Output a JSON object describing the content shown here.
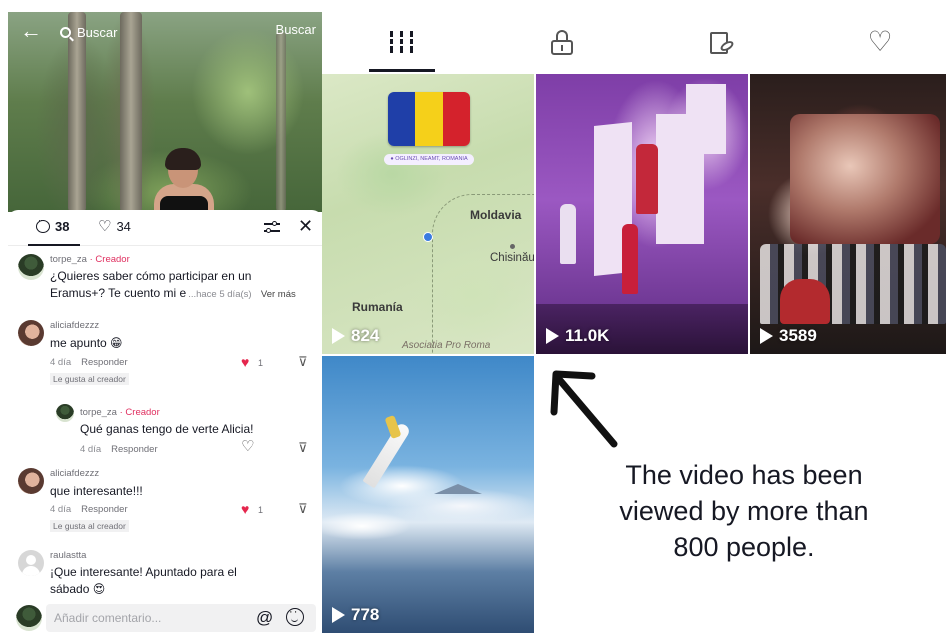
{
  "video": {
    "search_label": "Buscar",
    "search_button": "Buscar"
  },
  "comments_sheet": {
    "comment_count": "38",
    "like_count": "34",
    "comments": [
      {
        "username": "torpe_za",
        "creator_tag": "· Creador",
        "text_line1": "¿Quieres saber cómo participar en un",
        "text_line2": "Eramus+? Te cuento mi e",
        "time": "...hace 5 día(s)",
        "see_more": "Ver más"
      },
      {
        "username": "aliciafdezzz",
        "text": "me apunto 😁",
        "time": "4 día",
        "reply": "Responder",
        "likes": "1",
        "liked_by_creator": "Le gusta al creador",
        "replies": [
          {
            "username": "torpe_za",
            "creator_tag": "· Creador",
            "text": "Qué ganas tengo de verte Alicia!",
            "time": "4 día",
            "reply": "Responder"
          }
        ]
      },
      {
        "username": "aliciafdezzz",
        "text": "que interesante!!!",
        "time": "4 día",
        "reply": "Responder",
        "likes": "1",
        "liked_by_creator": "Le gusta al creador"
      },
      {
        "username": "raulastta",
        "text_line1": "¡Que interesante! Apuntado para el",
        "text_line2": "sábado 😍"
      }
    ],
    "input_placeholder": "Añadir comentario..."
  },
  "profile_tabs": [
    {
      "icon": "grid-icon",
      "active": true
    },
    {
      "icon": "lock-icon",
      "active": false
    },
    {
      "icon": "tagged-icon",
      "active": false
    },
    {
      "icon": "heart-icon",
      "active": false
    }
  ],
  "videos": [
    {
      "views": "824",
      "location": "● OGLINZI, NEAMT, ROMANIA",
      "map_labels": {
        "country": "Rumanía",
        "region": "Moldavia",
        "city": "Chisinău",
        "watermark": "Asociatia Pro Roma"
      }
    },
    {
      "views": "11.0K"
    },
    {
      "views": "3589"
    },
    {
      "views": "778"
    }
  ],
  "annotation": {
    "line1": "The video has been",
    "line2": "viewed by more than",
    "line3": "800 people."
  },
  "colors": {
    "creator": "#e03060",
    "like_red": "#e5264d",
    "flag_blue": "#1f3fa8",
    "flag_yellow": "#f5d01a",
    "flag_red": "#d4222c"
  }
}
